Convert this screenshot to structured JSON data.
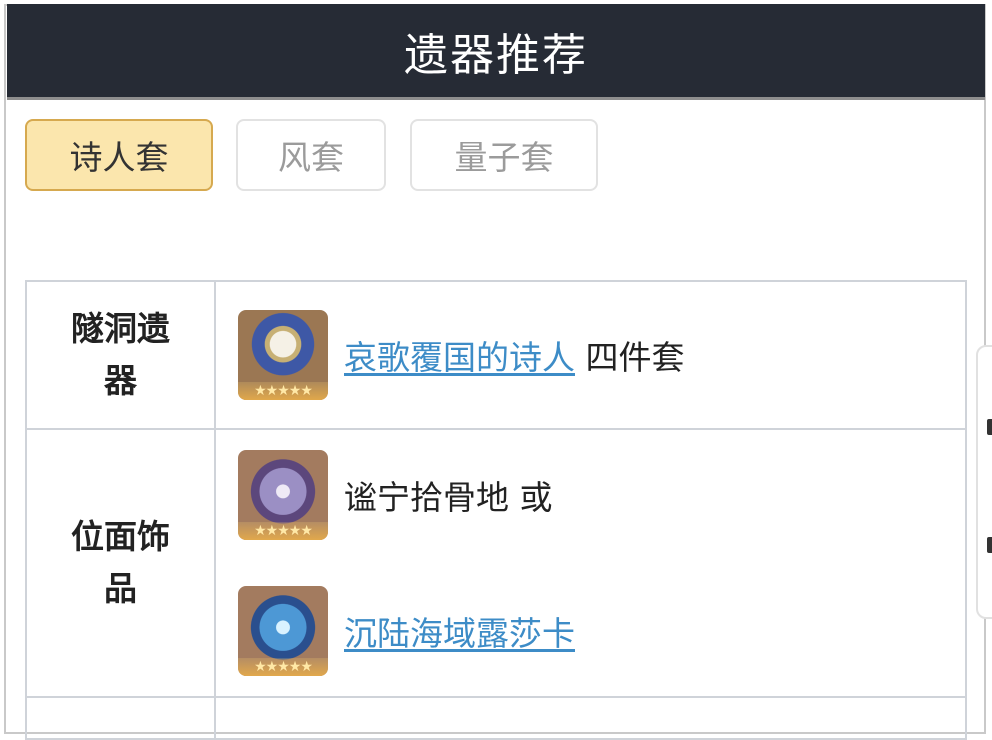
{
  "header": {
    "title": "遗器推荐"
  },
  "tabs": [
    {
      "label": "诗人套",
      "active": true
    },
    {
      "label": "风套",
      "active": false
    },
    {
      "label": "量子套",
      "active": false
    }
  ],
  "table": {
    "rows": [
      {
        "label": "隧洞遗器",
        "items": [
          {
            "icon": "crown-flower-relic-icon",
            "link_text": "哀歌覆国的诗人",
            "suffix": "四件套"
          }
        ]
      },
      {
        "label": "位面饰品",
        "items": [
          {
            "icon": "purple-orb-planar-icon",
            "text": "谧宁拾骨地 或"
          },
          {
            "icon": "blue-orb-planar-icon",
            "link_text": "沉陆海域露莎卡"
          }
        ]
      }
    ]
  },
  "colors": {
    "header_bg": "#262b35",
    "active_tab_bg": "#fbe6ad",
    "active_tab_border": "#d6a94f",
    "link": "#3d8cc7"
  }
}
